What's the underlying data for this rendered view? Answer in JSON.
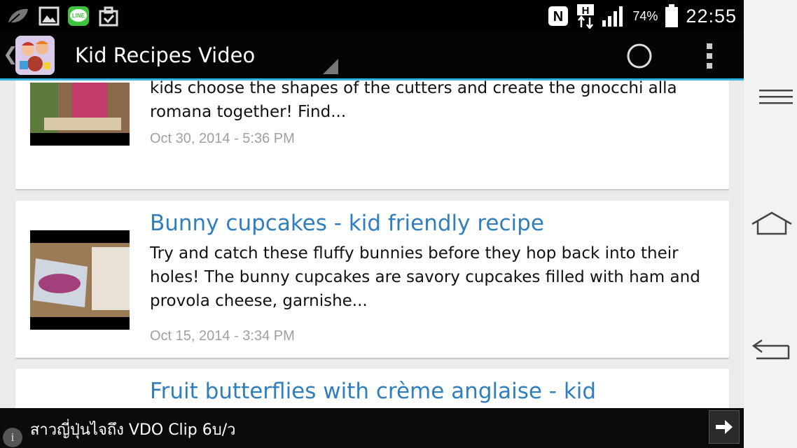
{
  "status_bar": {
    "battery_percent": "74%",
    "clock": "22:55",
    "icons": [
      "leaf-icon",
      "gallery-icon",
      "line-app-icon",
      "task-check-icon",
      "nfc-icon",
      "hspa-data-icon",
      "signal-icon",
      "battery-icon"
    ],
    "line_label": "LINE",
    "nfc_label": "N",
    "hspa_label": "H"
  },
  "action_bar": {
    "title": "Kid Recipes Video",
    "back_glyph": "❮",
    "icons": [
      "app-logo",
      "refresh-icon",
      "overflow-menu-icon"
    ]
  },
  "feed": {
    "items": [
      {
        "title": "",
        "description": "The semolina gnocchi with tomato sauce is a family favorite: let your kids choose the shapes of the cutters and create the gnocchi alla romana together! Find...",
        "date": "Oct 30, 2014 - 5:36 PM"
      },
      {
        "title": "Bunny cupcakes - kid friendly recipe",
        "description": "Try and catch these fluffy bunnies before they hop back into their holes! The bunny cupcakes are savory cupcakes filled with ham and provola cheese, garnishe...",
        "date": "Oct 15, 2014 - 3:34 PM"
      },
      {
        "title": "Fruit butterflies with crème anglaise - kid",
        "description": "",
        "date": ""
      }
    ]
  },
  "ad": {
    "text": "สาวญี่ปุ่นไจถึง VDO Clip 6บ/ว",
    "info_glyph": "i"
  },
  "nav_bar": {
    "buttons": [
      "menu-icon",
      "home-icon",
      "back-icon"
    ]
  },
  "colors": {
    "accent": "#33b5e5",
    "title_link": "#2f7fc0",
    "date_text": "#a0a0a0"
  }
}
